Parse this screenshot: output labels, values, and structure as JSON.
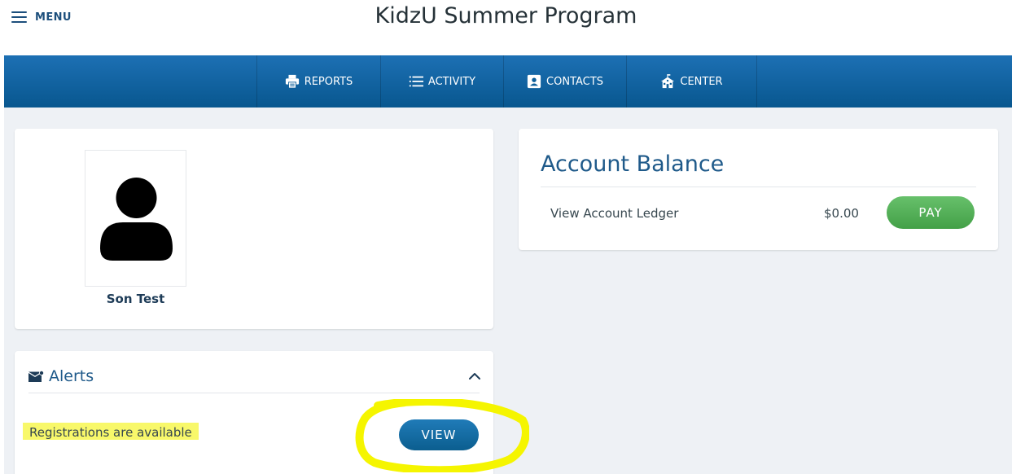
{
  "header": {
    "menu_label": "MENU",
    "title": "KidzU Summer Program"
  },
  "nav": {
    "items": [
      {
        "label": "REPORTS",
        "icon": "printer-icon"
      },
      {
        "label": "ACTIVITY",
        "icon": "list-icon"
      },
      {
        "label": "CONTACTS",
        "icon": "contact-card-icon"
      },
      {
        "label": "CENTER",
        "icon": "schoolhouse-icon"
      }
    ]
  },
  "profile": {
    "name": "Son Test",
    "avatar_icon": "person-silhouette-icon"
  },
  "account": {
    "title": "Account Balance",
    "ledger_link": "View Account Ledger",
    "balance": "$0.00",
    "pay_label": "PAY"
  },
  "alerts": {
    "title": "Alerts",
    "icon": "envelope-alert-icon",
    "toggle_icon": "chevron-up-icon",
    "items": [
      {
        "text": "Registrations are available",
        "action_label": "VIEW"
      }
    ]
  },
  "colors": {
    "brand_blue": "#1f5a8a",
    "nav_blue": "#1d70b4",
    "pay_green": "#4caf50",
    "view_blue": "#0f6a9f",
    "highlight_yellow": "#f8f86a",
    "annotation_yellow": "#f5f500",
    "content_bg": "#eef1f5"
  }
}
